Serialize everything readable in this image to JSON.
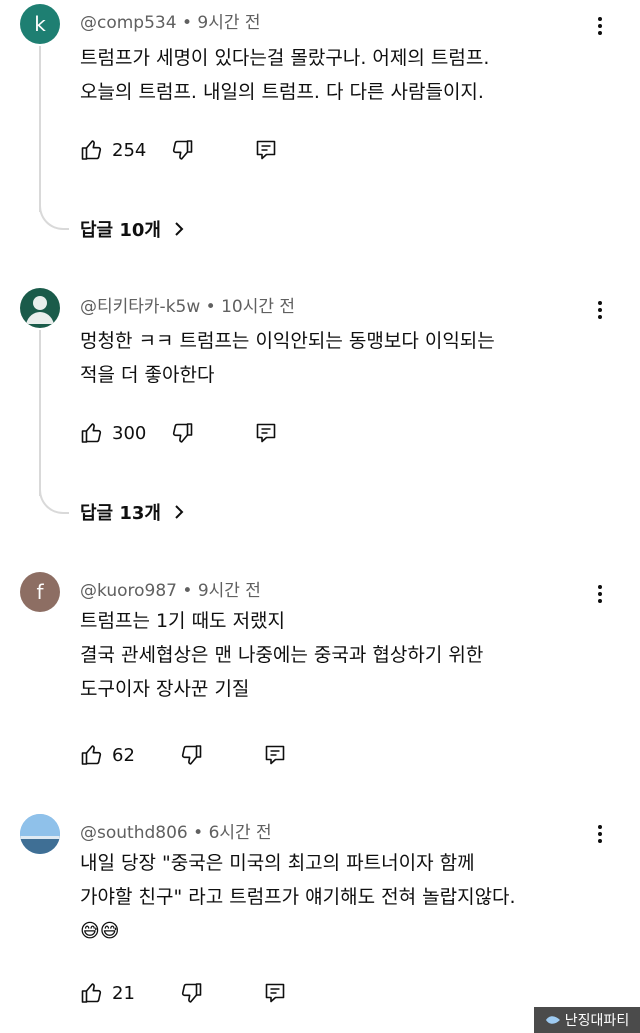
{
  "comments": [
    {
      "avatar_letter": "k",
      "avatar_color": "#1e7f72",
      "handle": "@comp534",
      "time": "9시간 전",
      "lines": [
        "트럼프가 세명이 있다는걸 몰랐구나. 어제의 트럼프.",
        "오늘의 트럼프. 내일의 트럼프. 다 다른 사람들이지."
      ],
      "likes": "254",
      "replies_label": "답글 10개"
    },
    {
      "avatar_letter": "",
      "avatar_color": "#1a5b4a",
      "handle": "@티키타카-k5w",
      "time": "10시간 전",
      "lines": [
        "멍청한 ㅋㅋ 트럼프는 이익안되는 동맹보다 이익되는",
        "적을 더 좋아한다"
      ],
      "likes": "300",
      "replies_label": "답글 13개"
    },
    {
      "avatar_letter": "f",
      "avatar_color": "#8d6e63",
      "handle": "@kuoro987",
      "time": "9시간 전",
      "lines": [
        "트럼프는 1기 때도 저랬지",
        "결국 관세협상은 맨 나중에는 중국과 협상하기 위한",
        "도구이자 장사꾼 기질"
      ],
      "likes": "62"
    },
    {
      "avatar_letter": "",
      "avatar_color": "#6fa8dc",
      "handle": "@southd806",
      "time": "6시간 전",
      "lines": [
        "내일 당장 \"중국은 미국의 최고의 파트너이자 함께",
        "가야할 친구\" 라고 트럼프가 얘기해도 전혀 놀랍지않다.",
        "😅😅"
      ],
      "likes": "21"
    }
  ],
  "meta_separator": "•",
  "watermark": "난징대파티"
}
